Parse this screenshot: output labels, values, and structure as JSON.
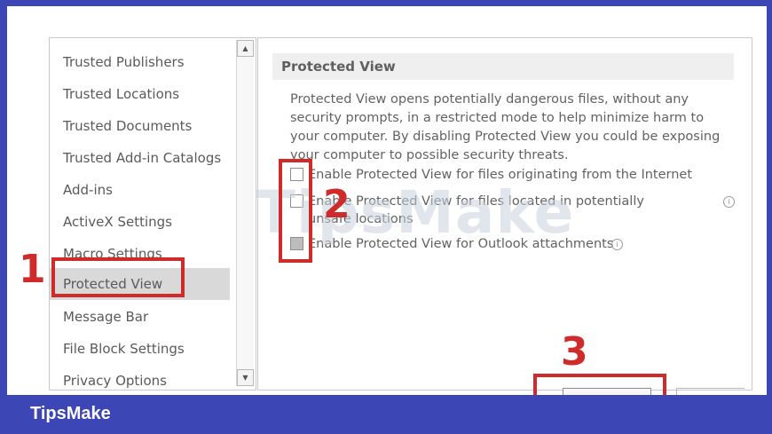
{
  "sidebar": {
    "items": [
      {
        "label": "Trusted Publishers"
      },
      {
        "label": "Trusted Locations"
      },
      {
        "label": "Trusted Documents"
      },
      {
        "label": "Trusted Add-in Catalogs"
      },
      {
        "label": "Add-ins"
      },
      {
        "label": "ActiveX Settings"
      },
      {
        "label": "Macro Settings"
      },
      {
        "label": "Protected View"
      },
      {
        "label": "Message Bar"
      },
      {
        "label": "File Block Settings"
      },
      {
        "label": "Privacy Options"
      }
    ],
    "selected": "Protected View"
  },
  "main": {
    "section_title": "Protected View",
    "description": "Protected View opens potentially dangerous files, without any security prompts, in a restricted mode to help minimize harm to your computer. By disabling Protected View you could be exposing your computer to possible security threats.",
    "options": [
      {
        "label": "Enable Protected View for files originating from the Internet",
        "checked": false
      },
      {
        "label": "Enable Protected View for files located in potentially unsafe locations",
        "checked": false
      },
      {
        "label": "Enable Protected View for Outlook attachments",
        "checked": true
      }
    ]
  },
  "annotations": {
    "step1": "1",
    "step2": "2",
    "step3": "3",
    "color": "#d02b2b"
  },
  "watermark": "TipsMake",
  "footer": {
    "brand": "TipsMake",
    "background": "#3c46b4"
  }
}
